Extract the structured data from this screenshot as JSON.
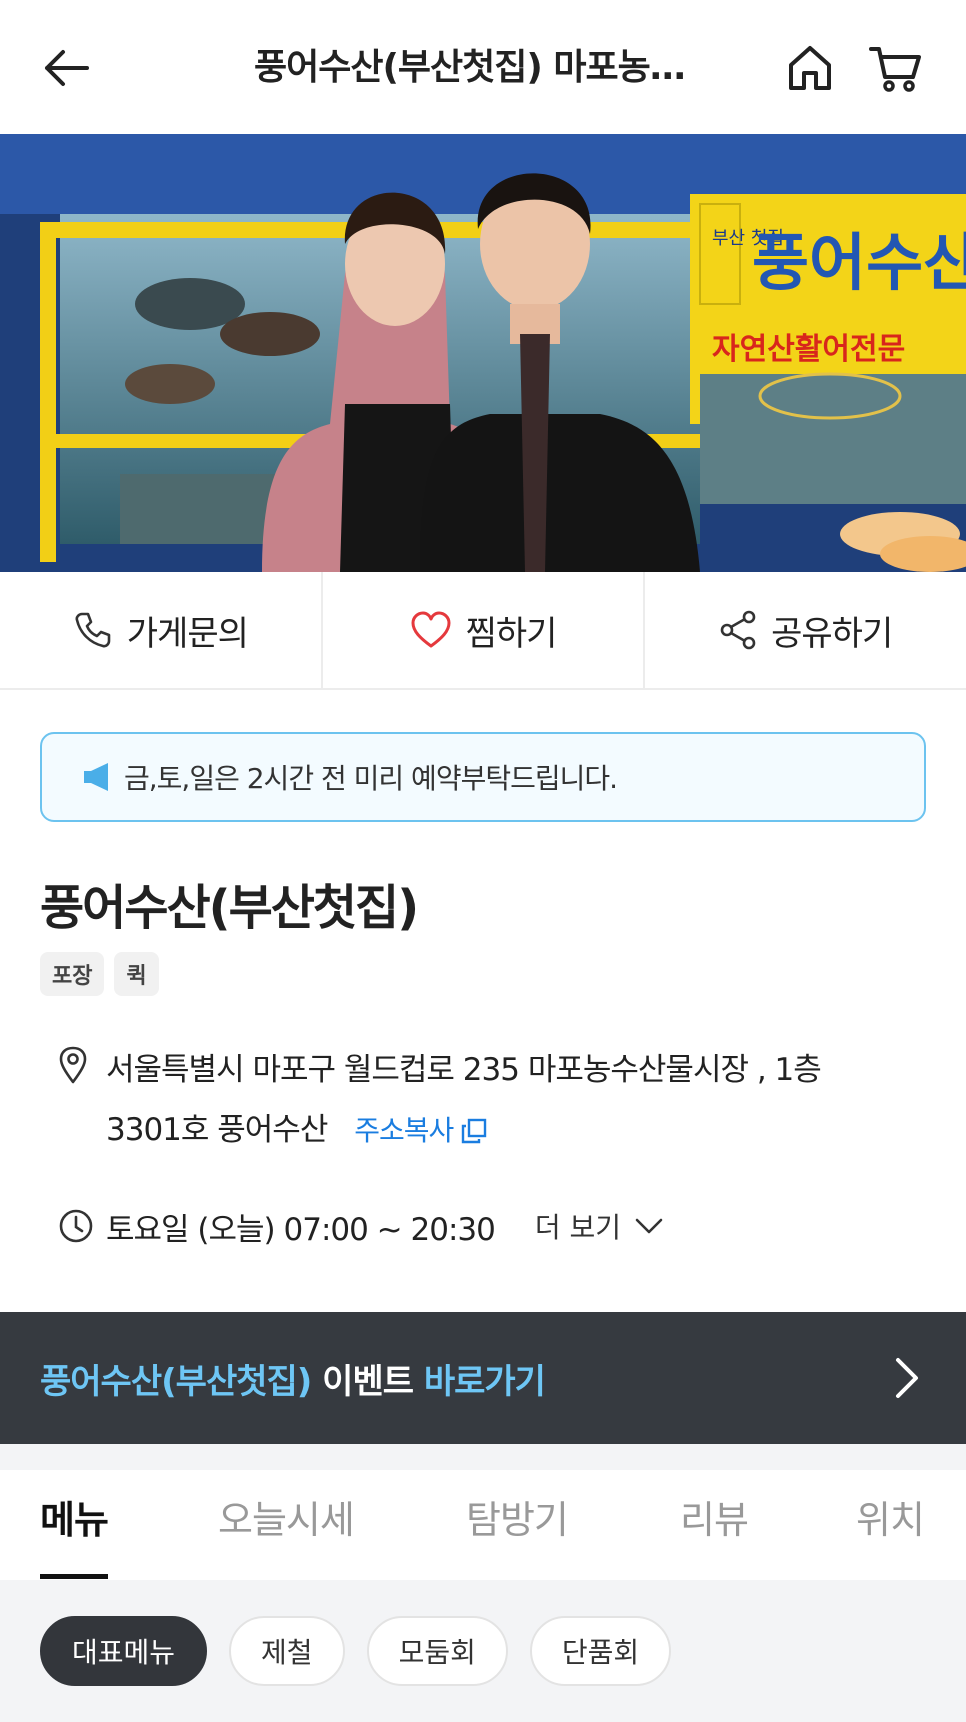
{
  "header": {
    "title": "풍어수산(부산첫집) 마포농…"
  },
  "hero": {
    "sign_main": "풍어수산",
    "sign_vertical": "부산 첫집",
    "sign_sub": "자연산활어전문"
  },
  "actions": [
    {
      "label": "가게문의",
      "icon": "phone-icon"
    },
    {
      "label": "찜하기",
      "icon": "heart-icon"
    },
    {
      "label": "공유하기",
      "icon": "share-icon"
    }
  ],
  "notice": {
    "text": "금,토,일은 2시간 전 미리 예약부탁드립니다."
  },
  "store": {
    "name": "풍어수산(부산첫집)",
    "badges": [
      "포장",
      "퀵"
    ],
    "address_line1": "서울특별시 마포구 월드컵로 235 마포농수산물시장 , 1층",
    "address_line2": "3301호 풍어수산",
    "copy_label": "주소복사",
    "hours": "토요일 (오늘) 07:00 ~ 20:30",
    "more_label": "더 보기"
  },
  "event": {
    "store": "풍어수산(부산첫집)",
    "middle": " 이벤트 ",
    "link": "바로가기"
  },
  "tabs": [
    "메뉴",
    "오늘시세",
    "탐방기",
    "리뷰",
    "위치"
  ],
  "chips": [
    "대표메뉴",
    "제철",
    "모둠회",
    "단품회"
  ],
  "colors": {
    "accent_blue": "#1a7de0",
    "notice_border": "#6cc3ef",
    "event_bg": "#363a40",
    "event_highlight": "#6ec6f5"
  }
}
